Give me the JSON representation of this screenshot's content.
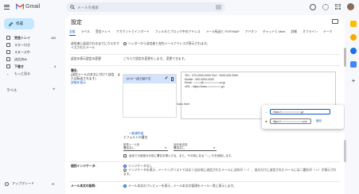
{
  "app": {
    "name": "Gmail"
  },
  "search": {
    "placeholder": "メールを検索"
  },
  "sidebar": {
    "compose": "作成",
    "items": [
      {
        "label": "受信トレイ",
        "count": "412"
      },
      {
        "label": "スター付き",
        "count": ""
      },
      {
        "label": "スヌーズ中",
        "count": ""
      },
      {
        "label": "送信済み",
        "count": ""
      },
      {
        "label": "下書き",
        "count": "3"
      },
      {
        "label": "もっと見る",
        "count": ""
      }
    ],
    "labels_heading": "ラベル",
    "upgrade": "アップグレード"
  },
  "settings": {
    "title": "設定",
    "tabs": [
      "全般",
      "ラベル",
      "受信トレイ",
      "アカウントとインポート",
      "フィルタとブロック中のアドレス",
      "メール転送と POP/IMAP",
      "アドオン",
      "チャットと Meet",
      "詳細",
      "オフライン",
      "テーマ"
    ],
    "row_top_label": "送信者に返送されるまでにカスタマイズされたメール",
    "row_top_value": "ヘッダーから送信者と宛先メールアドレスが表示されます。",
    "rows": {
      "scope_label": "返信の表示設定の変更",
      "scope_value": "こちらで設定の変更をします。 変更できます。",
      "signature_label": "署名:",
      "signature_sub": "(送信メールの本文に付けて送信、または転送されます)",
      "signature_sub2": "詳細を表示",
      "signature_name": "(小川一)自己紹介文",
      "new_signature": "+ 新規作成",
      "editor_lines": [
        "TEL : 070-0000-0000 FAX : 0000-000-0000",
        "Mobile : 090-0000-0000",
        "Email : ○○○○@○○○○○○○○○.co.jp",
        "URL : https://www.○○○○○○○○.jp/"
      ],
      "editor_side": "Sans Serif",
      "popup_link_url": "https://○○○○○○○○○○○○.jp/",
      "popup_edit_url": "https://○○○○○○○○○○○○○.com",
      "popup_apply": "適用",
      "defaults_title": "デフォルトの署名",
      "default_new_label": "新規メール用",
      "default_new_value": "署名なし",
      "default_reply_label": "返信/転送用",
      "default_reply_value": "署名なし",
      "defaults_check": "返信で引用部分の前に署名を挿入する。また、その前にある「--」行を削除します。",
      "indicator_label": "個別インジケータ:",
      "indicator_opt1": "インジケータなし",
      "indicator_opt2": "インジケータを表示 - メーリングリストではなく自分宛に送信されたメールには矢印（ › ）、自分だけに送信されたメールには二重矢印（ » ）が表示されます。",
      "preview_label": "メール本文の抜粋:",
      "preview_value": "メール本文のプレビューを表示 - メール本文の冒頭をメール一覧に表示します。"
    }
  },
  "colors": {
    "accent": "#0b57d0",
    "compose_bg": "#c2e7ff",
    "selected_item": "#d3e3fd"
  }
}
